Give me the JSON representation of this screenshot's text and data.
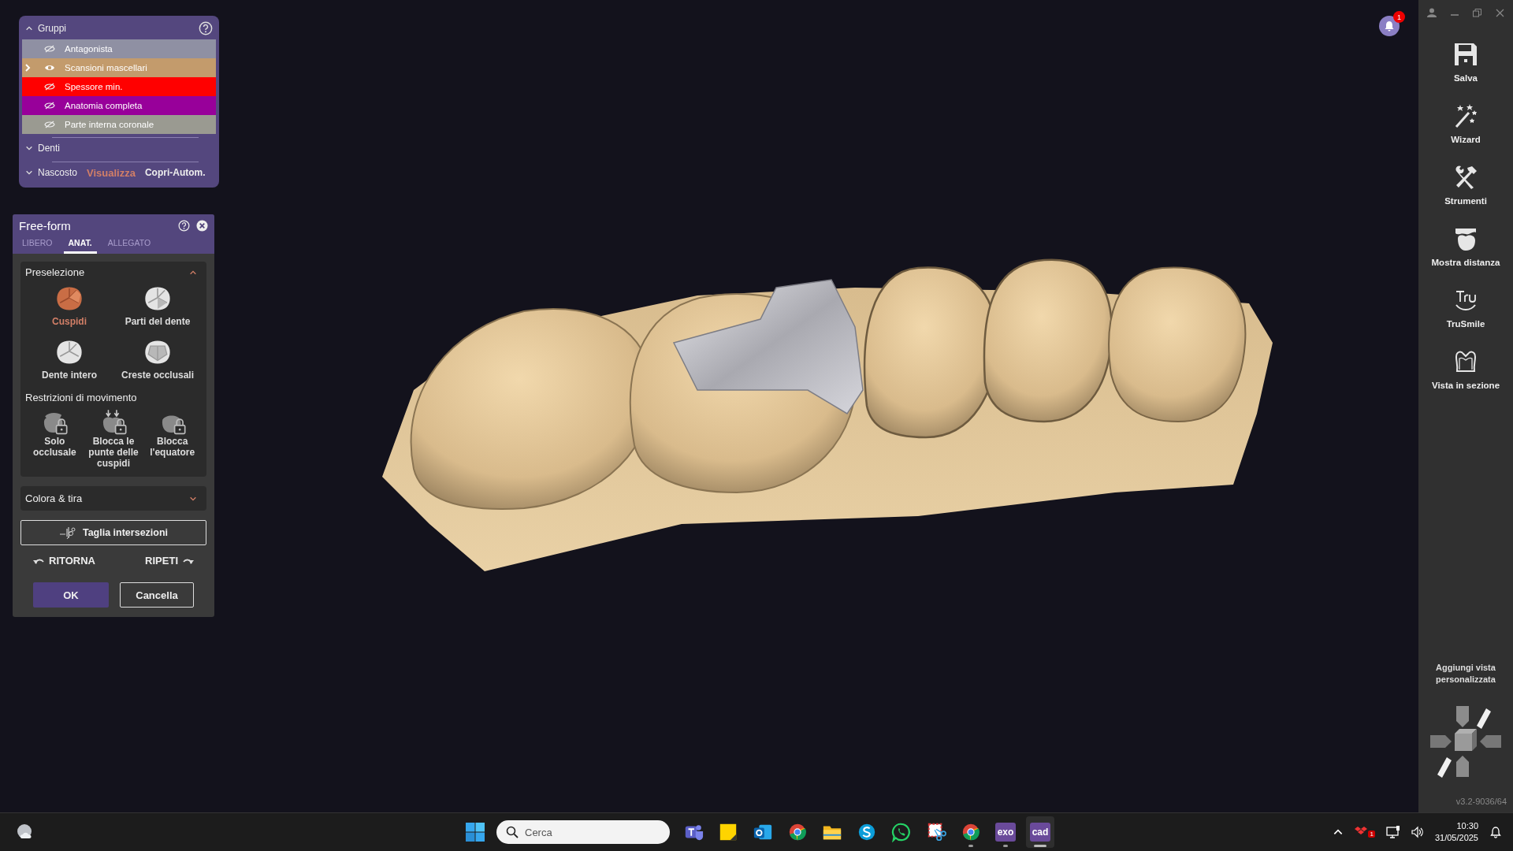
{
  "groups_panel": {
    "title": "Gruppi",
    "expanded": true,
    "items": [
      {
        "label": "Antagonista",
        "visible": false,
        "expandable": false,
        "color": "#8f90a3"
      },
      {
        "label": "Scansioni mascellari",
        "visible": true,
        "expandable": true,
        "color": "#c39b6c"
      },
      {
        "label": "Spessore min.",
        "visible": false,
        "expandable": false,
        "color": "#ff0000"
      },
      {
        "label": "Anatomia completa",
        "visible": false,
        "expandable": false,
        "color": "#98009a"
      },
      {
        "label": "Parte interna coronale",
        "visible": false,
        "expandable": false,
        "color": "#9a9a91"
      }
    ],
    "sections": [
      {
        "label": "Denti",
        "expanded": false
      }
    ],
    "footer": {
      "label": "Nascosto",
      "expanded": false,
      "actions": [
        {
          "label": "Visualizza",
          "kind": "accent"
        },
        {
          "label": "Copri-Autom.",
          "kind": "plain"
        }
      ]
    }
  },
  "freeform_panel": {
    "title": "Free-form",
    "tabs": [
      {
        "label": "LIBERO",
        "selected": false
      },
      {
        "label": "ANAT.",
        "selected": true
      },
      {
        "label": "ALLEGATO",
        "selected": false
      }
    ],
    "preselection": {
      "title": "Preselezione",
      "expanded": true,
      "options": [
        {
          "label": "Cuspidi",
          "kind": "cusps",
          "selected": true
        },
        {
          "label": "Parti del dente",
          "kind": "parts",
          "selected": false
        },
        {
          "label": "Dente intero",
          "kind": "whole",
          "selected": false
        },
        {
          "label": "Creste occlusali",
          "kind": "ridges",
          "selected": false
        }
      ]
    },
    "restrictions": {
      "title": "Restrizioni di movimento",
      "options": [
        {
          "label": "Solo occlusale",
          "kind": "occlusal"
        },
        {
          "label": "Blocca le punte delle cuspidi",
          "kind": "tips"
        },
        {
          "label": "Blocca l'equatore",
          "kind": "equator"
        }
      ]
    },
    "paint_section": {
      "title": "Colora & tira",
      "expanded": false
    },
    "cut_button": "Taglia intersezioni",
    "undo": "RITORNA",
    "redo": "RIPETI",
    "buttons": [
      {
        "label": "OK",
        "kind": "primary"
      },
      {
        "label": "Cancella",
        "kind": "secondary"
      }
    ]
  },
  "notifications": {
    "count": "1"
  },
  "toolbar": {
    "tools": [
      {
        "label": "Salva",
        "kind": "save"
      },
      {
        "label": "Wizard",
        "kind": "wand"
      },
      {
        "label": "Strumenti",
        "kind": "tools"
      },
      {
        "label": "Mostra distanza",
        "kind": "distance"
      },
      {
        "label": "TruSmile",
        "kind": "smile"
      },
      {
        "label": "Vista in sezione",
        "kind": "section"
      }
    ],
    "add_view": "Aggiungi vista personalizzata",
    "version": "v3.2-9036/64"
  },
  "taskbar": {
    "search": {
      "placeholder": "Cerca"
    },
    "apps": [
      {
        "kind": "teams",
        "running": false,
        "selected": false
      },
      {
        "kind": "notes",
        "running": false,
        "selected": false
      },
      {
        "kind": "outlook",
        "running": false,
        "selected": false
      },
      {
        "kind": "chrome",
        "running": false,
        "selected": false
      },
      {
        "kind": "folder",
        "running": false,
        "selected": false
      },
      {
        "kind": "skype",
        "running": false,
        "selected": false
      },
      {
        "kind": "whatsapp",
        "running": false,
        "selected": false
      },
      {
        "kind": "snip",
        "running": false,
        "selected": false
      },
      {
        "kind": "chrome",
        "running": true,
        "selected": false
      },
      {
        "kind": "labeled",
        "label": "exo",
        "running": true,
        "selected": false
      },
      {
        "kind": "labeled",
        "label": "cad",
        "running": true,
        "selected": true
      }
    ],
    "tray_badge": "1",
    "time": "10:30",
    "date": "31/05/2025"
  }
}
